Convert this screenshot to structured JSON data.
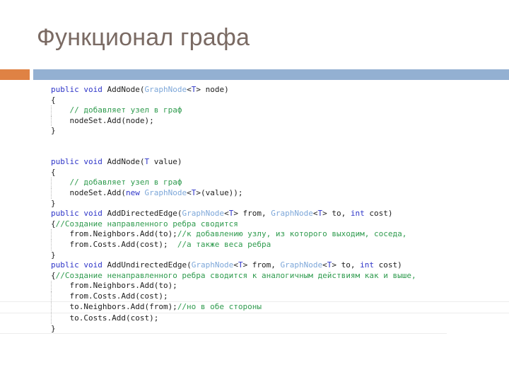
{
  "slide": {
    "title": "Функционал графа",
    "title_color": "#7a6a63",
    "accent_orange": "#df8244",
    "accent_blue": "#93b0d2"
  },
  "code": {
    "language": "csharp",
    "colors": {
      "keyword": "#2e35c8",
      "type": "#7da7d9",
      "comment": "#2f9b4e",
      "plain": "#1d1d1d",
      "guide": "#b9b9b9",
      "band": "#ededed"
    },
    "lines": [
      {
        "id": "l01",
        "tokens": [
          {
            "t": "public void ",
            "c": "kw"
          },
          {
            "t": "AddNode(",
            "c": "pl"
          },
          {
            "t": "GraphNode",
            "c": "typ"
          },
          {
            "t": "<",
            "c": "pl"
          },
          {
            "t": "T",
            "c": "kw"
          },
          {
            "t": "> node)",
            "c": "pl"
          }
        ],
        "guide": false
      },
      {
        "id": "l02",
        "tokens": [
          {
            "t": "{",
            "c": "pl"
          }
        ],
        "guide": false
      },
      {
        "id": "l03",
        "tokens": [
          {
            "t": "    ",
            "c": "pl"
          },
          {
            "t": "// добавляет узел в граф",
            "c": "cmt"
          }
        ],
        "guide": true
      },
      {
        "id": "l04",
        "tokens": [
          {
            "t": "    nodeSet.Add(node);",
            "c": "pl"
          }
        ],
        "guide": true
      },
      {
        "id": "l05",
        "tokens": [
          {
            "t": "}",
            "c": "pl"
          }
        ],
        "guide": false
      },
      {
        "id": "l06",
        "tokens": [
          {
            "t": " ",
            "c": "pl"
          }
        ],
        "guide": false
      },
      {
        "id": "l07",
        "tokens": [
          {
            "t": " ",
            "c": "pl"
          }
        ],
        "guide": false
      },
      {
        "id": "l08",
        "tokens": [
          {
            "t": "public void ",
            "c": "kw"
          },
          {
            "t": "AddNode(",
            "c": "pl"
          },
          {
            "t": "T",
            "c": "kw"
          },
          {
            "t": " value)",
            "c": "pl"
          }
        ],
        "guide": false
      },
      {
        "id": "l09",
        "tokens": [
          {
            "t": "{",
            "c": "pl"
          }
        ],
        "guide": false
      },
      {
        "id": "l10",
        "tokens": [
          {
            "t": "    ",
            "c": "pl"
          },
          {
            "t": "// добавляет узел в граф",
            "c": "cmt"
          }
        ],
        "guide": true
      },
      {
        "id": "l11",
        "tokens": [
          {
            "t": "    nodeSet.Add(",
            "c": "pl"
          },
          {
            "t": "new",
            "c": "kw"
          },
          {
            "t": " ",
            "c": "pl"
          },
          {
            "t": "GraphNode",
            "c": "typ"
          },
          {
            "t": "<",
            "c": "pl"
          },
          {
            "t": "T",
            "c": "kw"
          },
          {
            "t": ">(value));",
            "c": "pl"
          }
        ],
        "guide": true
      },
      {
        "id": "l12",
        "tokens": [
          {
            "t": "}",
            "c": "pl"
          }
        ],
        "guide": false
      },
      {
        "id": "l13",
        "tokens": [
          {
            "t": "public void ",
            "c": "kw"
          },
          {
            "t": "AddDirectedEdge(",
            "c": "pl"
          },
          {
            "t": "GraphNode",
            "c": "typ"
          },
          {
            "t": "<",
            "c": "pl"
          },
          {
            "t": "T",
            "c": "kw"
          },
          {
            "t": "> from, ",
            "c": "pl"
          },
          {
            "t": "GraphNode",
            "c": "typ"
          },
          {
            "t": "<",
            "c": "pl"
          },
          {
            "t": "T",
            "c": "kw"
          },
          {
            "t": "> to, ",
            "c": "pl"
          },
          {
            "t": "int",
            "c": "kw"
          },
          {
            "t": " cost)",
            "c": "pl"
          }
        ],
        "guide": false
      },
      {
        "id": "l14",
        "tokens": [
          {
            "t": "{",
            "c": "pl"
          },
          {
            "t": "//Создание направленного ребра сводится",
            "c": "cmt"
          }
        ],
        "guide": false
      },
      {
        "id": "l15",
        "tokens": [
          {
            "t": "    from.Neighbors.Add(to);",
            "c": "pl"
          },
          {
            "t": "//к добавлению узлу, из которого выходим, соседа,",
            "c": "cmt"
          }
        ],
        "guide": true
      },
      {
        "id": "l16",
        "tokens": [
          {
            "t": "    from.Costs.Add(cost);  ",
            "c": "pl"
          },
          {
            "t": "//а также веса ребра",
            "c": "cmt"
          }
        ],
        "guide": true
      },
      {
        "id": "l17",
        "tokens": [
          {
            "t": "}",
            "c": "pl"
          }
        ],
        "guide": false
      },
      {
        "id": "l18",
        "tokens": [
          {
            "t": "public void ",
            "c": "kw"
          },
          {
            "t": "AddUndirectedEdge(",
            "c": "pl"
          },
          {
            "t": "GraphNode",
            "c": "typ"
          },
          {
            "t": "<",
            "c": "pl"
          },
          {
            "t": "T",
            "c": "kw"
          },
          {
            "t": "> from, ",
            "c": "pl"
          },
          {
            "t": "GraphNode",
            "c": "typ"
          },
          {
            "t": "<",
            "c": "pl"
          },
          {
            "t": "T",
            "c": "kw"
          },
          {
            "t": "> to, ",
            "c": "pl"
          },
          {
            "t": "int",
            "c": "kw"
          },
          {
            "t": " cost)",
            "c": "pl"
          }
        ],
        "guide": false
      },
      {
        "id": "l19",
        "tokens": [
          {
            "t": "{",
            "c": "pl"
          },
          {
            "t": "//Создание ненаправленного ребра сводится к аналогичным действиям как и выше,",
            "c": "cmt"
          }
        ],
        "guide": false
      },
      {
        "id": "l20",
        "tokens": [
          {
            "t": "    from.Neighbors.Add(to);",
            "c": "pl"
          }
        ],
        "guide": true
      },
      {
        "id": "l21",
        "tokens": [
          {
            "t": "    from.Costs.Add(cost);",
            "c": "pl"
          }
        ],
        "guide": true
      },
      {
        "id": "l22",
        "tokens": [
          {
            "t": "    to.Neighbors.Add(from);",
            "c": "pl"
          },
          {
            "t": "//но в обе стороны",
            "c": "cmt"
          }
        ],
        "guide": true,
        "band": true
      },
      {
        "id": "l23",
        "tokens": [
          {
            "t": "    to.Costs.Add(cost);",
            "c": "pl"
          }
        ],
        "guide": true
      },
      {
        "id": "l24",
        "tokens": [
          {
            "t": "}",
            "c": "pl"
          }
        ],
        "guide": false,
        "bottom_rule": true
      }
    ]
  }
}
